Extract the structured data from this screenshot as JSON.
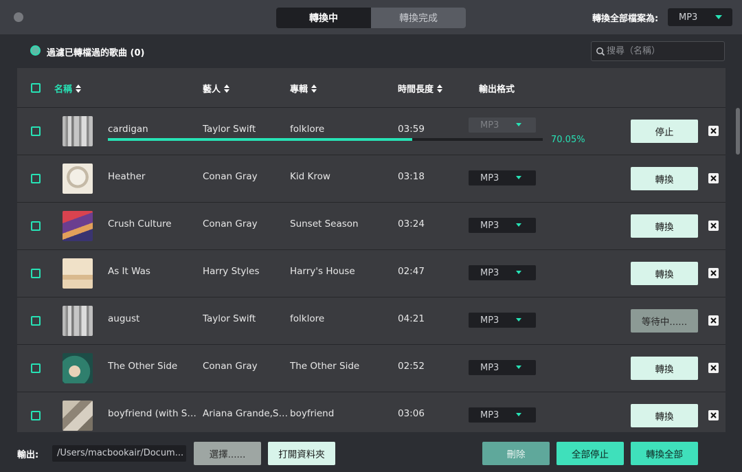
{
  "header": {
    "tabs": [
      {
        "label": "轉換中",
        "active": true
      },
      {
        "label": "轉換完成",
        "active": false
      }
    ],
    "convert_all_label": "轉換全部檔案為:",
    "format_value": "MP3"
  },
  "filter": {
    "label": "過濾已轉檔過的歌曲 (0)"
  },
  "search": {
    "placeholder": "搜尋（名稱）"
  },
  "table": {
    "columns": [
      "名稱",
      "藝人",
      "專輯",
      "時間長度",
      "輸出格式"
    ],
    "rows": [
      {
        "title": "cardigan",
        "artist": "Taylor Swift",
        "album": "folklore",
        "duration": "03:59",
        "format": "MP3",
        "action": "停止",
        "progress": 70.05,
        "progress_label": "70.05%"
      },
      {
        "title": "Heather",
        "artist": "Conan Gray",
        "album": "Kid Krow",
        "duration": "03:18",
        "format": "MP3",
        "action": "轉換"
      },
      {
        "title": "Crush Culture",
        "artist": "Conan Gray",
        "album": "Sunset Season",
        "duration": "03:24",
        "format": "MP3",
        "action": "轉換"
      },
      {
        "title": "As It Was",
        "artist": "Harry Styles",
        "album": "Harry's House",
        "duration": "02:47",
        "format": "MP3",
        "action": "轉換"
      },
      {
        "title": "august",
        "artist": "Taylor Swift",
        "album": "folklore",
        "duration": "04:21",
        "format": "MP3",
        "action": "等待中......"
      },
      {
        "title": "The Other Side",
        "artist": "Conan Gray",
        "album": "The Other Side",
        "duration": "02:52",
        "format": "MP3",
        "action": "轉換"
      },
      {
        "title": "boyfriend (with Soc...",
        "artist": "Ariana Grande,So...",
        "album": "boyfriend",
        "duration": "03:06",
        "format": "MP3",
        "action": "轉換"
      }
    ]
  },
  "footer": {
    "output_label": "輸出:",
    "output_path": "/Users/macbookair/Docum...",
    "choose": "選擇......",
    "open_folder": "打開資料夾",
    "delete": "刪除",
    "stop_all": "全部停止",
    "convert_all": "轉換全部"
  },
  "colors": {
    "accent": "#27e2b5",
    "background": "#2c2e33",
    "table": "#3a3b3f",
    "button_light": "#d8f4ea"
  }
}
